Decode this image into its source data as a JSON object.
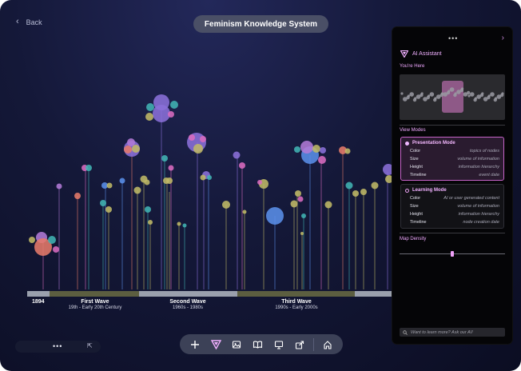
{
  "nav": {
    "back_label": "Back"
  },
  "header": {
    "title": "Feminism Knowledge System"
  },
  "colors": {
    "pink": "#d86bbf",
    "purple": "#8a6fd8",
    "blue": "#5a8ee8",
    "olive": "#bfb867",
    "teal": "#41b3b3",
    "salmon": "#e57a6a",
    "lilac": "#b07ad6"
  },
  "timeline": {
    "start_year": "1894",
    "eras": [
      {
        "name": "First Wave",
        "dates": "19th - Early 20th Century"
      },
      {
        "name": "Second Wave",
        "dates": "1960s - 1980s"
      },
      {
        "name": "Third Wave",
        "dates": "1990s - Early 2000s"
      }
    ]
  },
  "minimap": {
    "menu_icon": "more-dots-icon",
    "expand_icon": "expand-icon"
  },
  "toolbar": {
    "icons": [
      "plus-icon",
      "logo-icon",
      "image-icon",
      "book-icon",
      "presentation-icon",
      "share-icon",
      "home-icon"
    ]
  },
  "panel": {
    "title": "AI Assistant",
    "location_label": "You're Here",
    "view_modes_label": "View Modes",
    "modes": [
      {
        "name": "Presentation Mode",
        "selected": true,
        "rows": [
          {
            "key": "Color",
            "value": "topics of nodes"
          },
          {
            "key": "Size",
            "value": "volume of information"
          },
          {
            "key": "Height",
            "value": "information hierarchy"
          },
          {
            "key": "Timeline",
            "value": "event date"
          }
        ]
      },
      {
        "name": "Learning Mode",
        "selected": false,
        "rows": [
          {
            "key": "Color",
            "value": "AI or user generated content"
          },
          {
            "key": "Size",
            "value": "volume of information"
          },
          {
            "key": "Height",
            "value": "information hierarchy"
          },
          {
            "key": "Timeline",
            "value": "node creation date"
          }
        ]
      }
    ],
    "density_label": "Map Density",
    "density_value": 0.5,
    "ask_placeholder": "Want to learn more? Ask our AI!"
  }
}
